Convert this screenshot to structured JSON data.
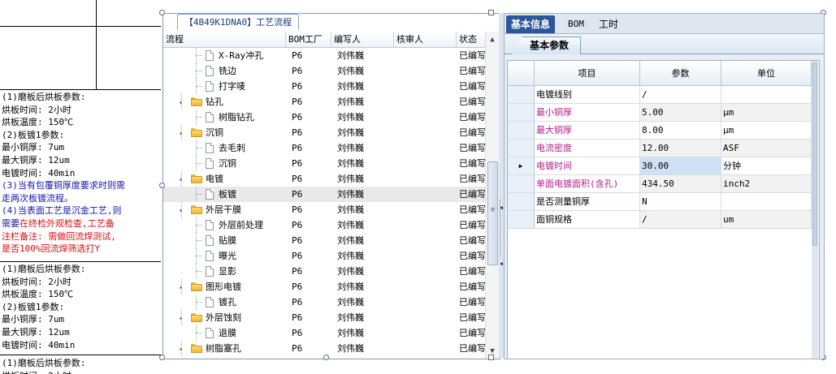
{
  "left_notes": {
    "blocks": [
      {
        "lines": [
          {
            "text": "(1)磨板后烘板参数:",
            "color": "black"
          },
          {
            "text": "烘板时间: 2小时",
            "color": "black"
          },
          {
            "text": "烘板温度: 150℃",
            "color": "black"
          },
          {
            "text": "(2)板镀1参数:",
            "color": "black"
          },
          {
            "text": "最小铜厚: 7um",
            "color": "black"
          },
          {
            "text": "最大铜厚: 12um",
            "color": "black"
          },
          {
            "text": "电镀时间: 40min",
            "color": "black"
          },
          {
            "text": "(3)当有包覆铜厚度要求时则需",
            "color": "blue"
          },
          {
            "text": "走两次板镀流程。",
            "color": "blue"
          },
          {
            "text": "(4)当表面工艺是沉金工艺,则",
            "color": "blue"
          },
          {
            "text": "需要在终检外观检查,工艺备",
            "color": "mixed"
          },
          {
            "text": "注栏备注: 需做回流焊测试,",
            "color": "red"
          },
          {
            "text": "是否100%回流焊筛选打Y",
            "color": "red"
          }
        ]
      },
      {
        "lines": [
          {
            "text": "(1)磨板后烘板参数:",
            "color": "black"
          },
          {
            "text": "烘板时间: 2小时",
            "color": "black"
          },
          {
            "text": "烘板温度: 150℃",
            "color": "black"
          },
          {
            "text": "(2)板镀1参数:",
            "color": "black"
          },
          {
            "text": "最小铜厚: 7um",
            "color": "black"
          },
          {
            "text": "最大铜厚: 12um",
            "color": "black"
          },
          {
            "text": "电镀时间: 40min",
            "color": "black"
          }
        ]
      },
      {
        "lines": [
          {
            "text": "(1)磨板后烘板参数:",
            "color": "black"
          },
          {
            "text": "烘板时间: 2小时",
            "color": "black"
          }
        ]
      }
    ],
    "mixed_prefix": "需要",
    "mixed_rest": "在终检外观检查,工艺备"
  },
  "tree_panel": {
    "title": "【4B49K1DNA0】工艺流程",
    "columns": [
      "流程",
      "BOM工厂",
      "编写人",
      "核审人",
      "状态"
    ],
    "rows": [
      {
        "level": 2,
        "type": "doc",
        "name": "X-Ray冲孔",
        "factory": "P6",
        "author": "刘伟巍",
        "reviewer": "",
        "status": "已编写"
      },
      {
        "level": 2,
        "type": "doc",
        "name": "铣边",
        "factory": "P6",
        "author": "刘伟巍",
        "reviewer": "",
        "status": "已编写"
      },
      {
        "level": 2,
        "type": "doc",
        "name": "打字唛",
        "factory": "P6",
        "author": "刘伟巍",
        "reviewer": "",
        "status": "已编写"
      },
      {
        "level": 1,
        "type": "folder",
        "name": "钻孔",
        "factory": "P6",
        "author": "刘伟巍",
        "reviewer": "",
        "status": "已编写"
      },
      {
        "level": 2,
        "type": "doc",
        "name": "树脂钻孔",
        "factory": "P6",
        "author": "刘伟巍",
        "reviewer": "",
        "status": "已编写"
      },
      {
        "level": 1,
        "type": "folder",
        "name": "沉铜",
        "factory": "P6",
        "author": "刘伟巍",
        "reviewer": "",
        "status": "已编写"
      },
      {
        "level": 2,
        "type": "doc",
        "name": "去毛刺",
        "factory": "P6",
        "author": "刘伟巍",
        "reviewer": "",
        "status": "已编写"
      },
      {
        "level": 2,
        "type": "doc",
        "name": "沉铜",
        "factory": "P6",
        "author": "刘伟巍",
        "reviewer": "",
        "status": "已编写"
      },
      {
        "level": 1,
        "type": "folder",
        "name": "电镀",
        "factory": "P6",
        "author": "刘伟巍",
        "reviewer": "",
        "status": "已编写"
      },
      {
        "level": 2,
        "type": "doc",
        "name": "板镀",
        "factory": "P6",
        "author": "刘伟巍",
        "reviewer": "",
        "status": "已编写",
        "selected": true
      },
      {
        "level": 1,
        "type": "folder",
        "name": "外层干膜",
        "factory": "P6",
        "author": "刘伟巍",
        "reviewer": "",
        "status": "已编写"
      },
      {
        "level": 2,
        "type": "doc",
        "name": "外层前处理",
        "factory": "P6",
        "author": "刘伟巍",
        "reviewer": "",
        "status": "已编写"
      },
      {
        "level": 2,
        "type": "doc",
        "name": "贴膜",
        "factory": "P6",
        "author": "刘伟巍",
        "reviewer": "",
        "status": "已编写"
      },
      {
        "level": 2,
        "type": "doc",
        "name": "曝光",
        "factory": "P6",
        "author": "刘伟巍",
        "reviewer": "",
        "status": "已编写"
      },
      {
        "level": 2,
        "type": "doc",
        "name": "显影",
        "factory": "P6",
        "author": "刘伟巍",
        "reviewer": "",
        "status": "已编写"
      },
      {
        "level": 1,
        "type": "folder",
        "name": "图形电镀",
        "factory": "P6",
        "author": "刘伟巍",
        "reviewer": "",
        "status": "已编写"
      },
      {
        "level": 2,
        "type": "doc",
        "name": "镀孔",
        "factory": "P6",
        "author": "刘伟巍",
        "reviewer": "",
        "status": "已编写"
      },
      {
        "level": 1,
        "type": "folder",
        "name": "外层蚀刻",
        "factory": "P6",
        "author": "刘伟巍",
        "reviewer": "",
        "status": "已编写"
      },
      {
        "level": 2,
        "type": "doc",
        "name": "退膜",
        "factory": "P6",
        "author": "刘伟巍",
        "reviewer": "",
        "status": "已编写"
      },
      {
        "level": 1,
        "type": "folder",
        "name": "树脂塞孔",
        "factory": "P6",
        "author": "刘伟巍",
        "reviewer": "",
        "status": "已编写"
      }
    ]
  },
  "prop_panel": {
    "top_tabs": [
      "基本信息",
      "BOM",
      "工时"
    ],
    "active_top_tab": 0,
    "sub_tab": "基本参数",
    "grid_columns": [
      "项目",
      "参数",
      "单位"
    ],
    "grid_rows": [
      {
        "item": "电镀线别",
        "value": "/",
        "unit": "",
        "red": false
      },
      {
        "item": "最小铜厚",
        "value": "5.00",
        "unit": "μm",
        "red": true
      },
      {
        "item": "最大铜厚",
        "value": "8.00",
        "unit": "μm",
        "red": true
      },
      {
        "item": "电流密度",
        "value": "12.00",
        "unit": "ASF",
        "red": true
      },
      {
        "item": "电镀时间",
        "value": "30.00",
        "unit": "分钟",
        "red": true,
        "current": true
      },
      {
        "item": "单面电镀面积(含孔)",
        "value": "434.50",
        "unit": "inch2",
        "red": true
      },
      {
        "item": "是否测量铜厚",
        "value": "N",
        "unit": "",
        "red": false
      },
      {
        "item": "面铜规格",
        "value": "/",
        "unit": "um",
        "red": false
      }
    ]
  },
  "colors": {
    "note_blue": "#1515b0",
    "note_red": "#d01010",
    "param_label": "#b0208c",
    "active_tab": "#2b579a"
  }
}
